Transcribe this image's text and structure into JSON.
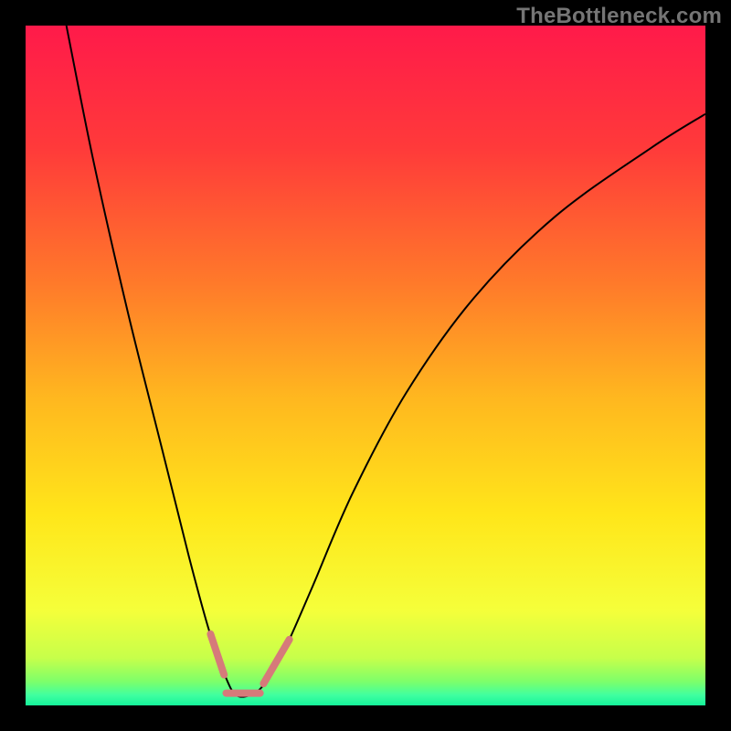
{
  "watermark": "TheBottleneck.com",
  "chart_data": {
    "type": "line",
    "title": "",
    "xlabel": "",
    "ylabel": "",
    "xlim": [
      0,
      100
    ],
    "ylim": [
      0,
      100
    ],
    "gradient_background": {
      "orientation": "vertical",
      "stops": [
        {
          "offset": 0.0,
          "color": "#ff1a4a"
        },
        {
          "offset": 0.18,
          "color": "#ff3a3a"
        },
        {
          "offset": 0.38,
          "color": "#ff7a2a"
        },
        {
          "offset": 0.55,
          "color": "#ffb81f"
        },
        {
          "offset": 0.72,
          "color": "#ffe61a"
        },
        {
          "offset": 0.86,
          "color": "#f5ff3a"
        },
        {
          "offset": 0.93,
          "color": "#c7ff4a"
        },
        {
          "offset": 0.965,
          "color": "#7dff6a"
        },
        {
          "offset": 0.985,
          "color": "#3fffa0"
        },
        {
          "offset": 1.0,
          "color": "#15f49a"
        }
      ]
    },
    "series": [
      {
        "name": "bottleneck-curve",
        "color": "#000000",
        "stroke_width": 2,
        "x": [
          6,
          10,
          15,
          20,
          24,
          27,
          29.5,
          31,
          33,
          35,
          38,
          42,
          48,
          56,
          66,
          78,
          92,
          100
        ],
        "y": [
          100,
          80,
          58,
          38,
          22,
          11,
          4,
          1.5,
          1.5,
          3,
          8,
          17,
          31,
          46,
          60,
          72,
          82,
          87
        ]
      }
    ],
    "highlight_segments": [
      {
        "name": "left-marker",
        "color": "#d67a7a",
        "stroke_width": 8,
        "linecap": "round",
        "x": [
          27.2,
          29.2
        ],
        "y": [
          10.5,
          4.5
        ]
      },
      {
        "name": "bottom-marker",
        "color": "#d67a7a",
        "stroke_width": 8,
        "linecap": "round",
        "x": [
          29.5,
          34.5
        ],
        "y": [
          1.8,
          1.8
        ]
      },
      {
        "name": "right-marker",
        "color": "#d67a7a",
        "stroke_width": 8,
        "linecap": "round",
        "x": [
          35.0,
          38.8
        ],
        "y": [
          3.2,
          9.7
        ]
      }
    ]
  }
}
